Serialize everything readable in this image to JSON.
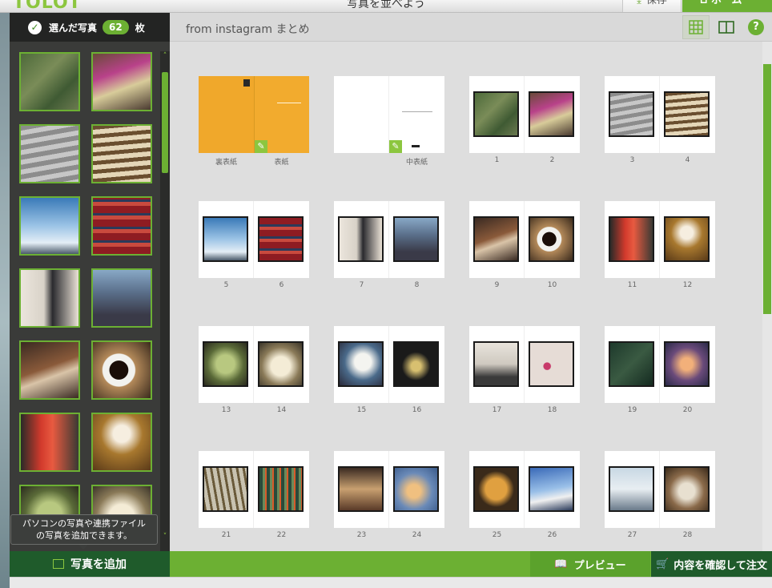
{
  "app": {
    "logo": "TOLOT",
    "title": "写真を並べよう"
  },
  "toolbar": {
    "save_label": "保存",
    "home_label": "ホーム"
  },
  "left": {
    "selected_label": "選んだ写真",
    "selected_count": "62",
    "count_unit": "枚",
    "tooltip_line1": "パソコンの写真や連携ファイル",
    "tooltip_line2": "の写真を追加できます。",
    "add_label": "写真を追加"
  },
  "album": {
    "title": "from instagram まとめ"
  },
  "help_label": "?",
  "page_labels": {
    "back_cover": "裏表紙",
    "front_cover": "表紙",
    "inner_cover": "中表紙"
  },
  "pages": [
    "1",
    "2",
    "3",
    "4",
    "5",
    "6",
    "7",
    "8",
    "9",
    "10",
    "11",
    "12",
    "13",
    "14",
    "15",
    "16",
    "17",
    "18",
    "19",
    "20",
    "21",
    "22",
    "23",
    "24",
    "25",
    "26",
    "27",
    "28"
  ],
  "bottom": {
    "preview_label": "プレビュー",
    "order_label": "内容を確認して注文"
  },
  "colors": {
    "accent": "#6cb033",
    "dark_green": "#1f5b2b",
    "panel": "#303230"
  }
}
